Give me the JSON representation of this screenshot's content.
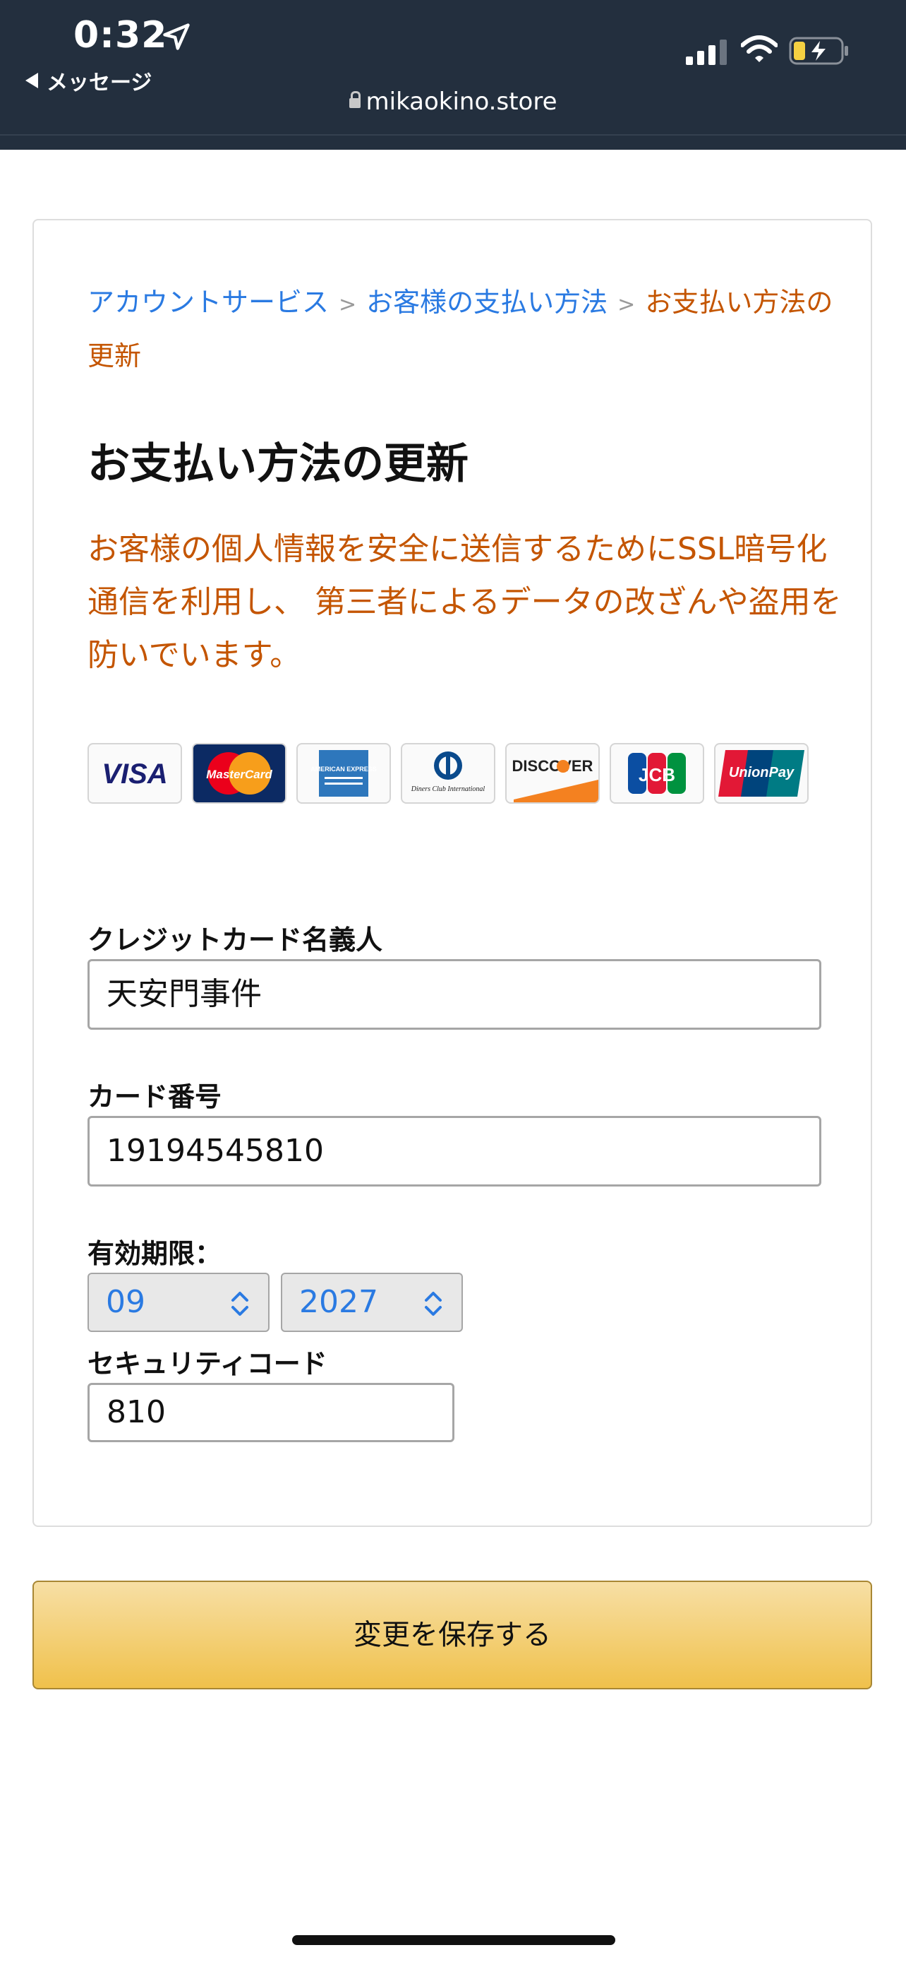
{
  "status_bar": {
    "time": "0:32",
    "back_label": "メッセージ",
    "url": "mikaokino.store",
    "battery_color": "#f5d142"
  },
  "breadcrumb": {
    "items": [
      "アカウントサービス",
      "お客様の支払い方法"
    ],
    "current": "お支払い方法の更新",
    "separator": ">"
  },
  "page": {
    "title": "お支払い方法の更新",
    "notice": "お客様の個人情報を安全に送信するためにSSL暗号化通信を利用し、 第三者によるデータの改ざんや盗用を防いでいます。"
  },
  "card_brands": {
    "visa": "VISA",
    "mastercard": "MasterCard",
    "amex": "AMERICAN EXPRESS",
    "diners": "Diners Club International",
    "discover": "DISCOVER",
    "jcb": "JCB",
    "unionpay": "UnionPay"
  },
  "form": {
    "name_label": "クレジットカード名義人",
    "name_value": "天安門事件",
    "number_label": "カード番号",
    "number_value": "19194545810",
    "expiry_label": "有効期限：",
    "expiry_month": "09",
    "expiry_year": "2027",
    "cvv_label": "セキュリティコード",
    "cvv_value": "810"
  },
  "actions": {
    "save_label": "変更を保存する"
  },
  "colors": {
    "header_bg": "#232f3e",
    "link": "#2a7ae2",
    "accent_orange": "#c45500",
    "button_top": "#f7dfa5",
    "button_bottom": "#f0c14b"
  }
}
